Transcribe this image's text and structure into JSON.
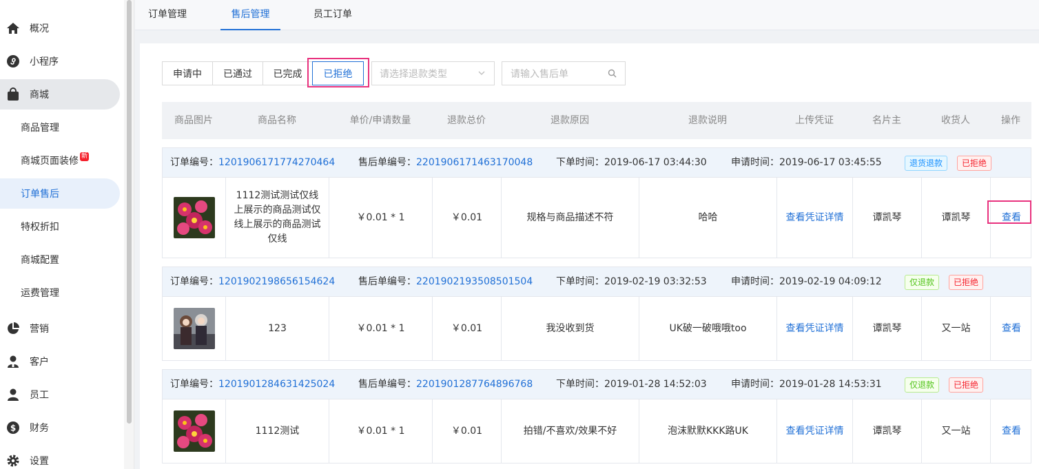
{
  "sidebar": {
    "items": [
      {
        "label": "概况",
        "icon": "home-icon"
      },
      {
        "label": "小程序",
        "icon": "mini-program-icon"
      },
      {
        "label": "商城",
        "icon": "shopping-bag-icon"
      },
      {
        "label": "商品管理"
      },
      {
        "label": "商城页面装修",
        "badge": "新"
      },
      {
        "label": "订单售后"
      },
      {
        "label": "特权折扣"
      },
      {
        "label": "商城配置"
      },
      {
        "label": "运费管理"
      },
      {
        "label": "营销",
        "icon": "pie-chart-icon"
      },
      {
        "label": "客户",
        "icon": "customer-icon"
      },
      {
        "label": "员工",
        "icon": "user-icon"
      },
      {
        "label": "财务",
        "icon": "dollar-icon"
      },
      {
        "label": "设置",
        "icon": "gear-icon"
      }
    ]
  },
  "tabs": [
    "订单管理",
    "售后管理",
    "员工订单"
  ],
  "filters": {
    "status": [
      "申请中",
      "已通过",
      "已完成",
      "已拒绝"
    ],
    "refund_type_placeholder": "请选择退款类型",
    "search_placeholder": "请输入售后单"
  },
  "table": {
    "headers": [
      "商品图片",
      "商品名称",
      "单价/申请数量",
      "退款总价",
      "退款原因",
      "退款说明",
      "上传凭证",
      "名片主",
      "收货人",
      "操作"
    ],
    "labels": {
      "order_no": "订单编号：",
      "aftersale_no": "售后单编号：",
      "order_time": "下单时间：",
      "apply_time": "申请时间："
    },
    "orders": [
      {
        "order_no": "1201906171774270464",
        "aftersale_no": "2201906171463170048",
        "order_time": "2019-06-17 03:44:30",
        "apply_time": "2019-06-17 03:45:55",
        "type_tag": "退货退款",
        "status_tag": "已拒绝",
        "product_name": "1112测试测试仅线上展示的商品测试仅线上展示的商品测试仅线",
        "price_qty": "￥0.01 * 1",
        "refund_total": "￥0.01",
        "reason": "规格与商品描述不符",
        "description": "哈哈",
        "proof_link": "查看凭证详情",
        "card_owner": "谭凯琴",
        "receiver": "谭凯琴",
        "action": "查看"
      },
      {
        "order_no": "1201902198656154624",
        "aftersale_no": "2201902193508501504",
        "order_time": "2019-02-19 03:32:53",
        "apply_time": "2019-02-19 04:09:12",
        "type_tag": "仅退款",
        "status_tag": "已拒绝",
        "product_name": "123",
        "price_qty": "￥0.01 * 1",
        "refund_total": "￥0.01",
        "reason": "我没收到货",
        "description": "UK破一破哦哦too",
        "proof_link": "查看凭证详情",
        "card_owner": "谭凯琴",
        "receiver": "又一站",
        "action": "查看"
      },
      {
        "order_no": "1201901284631425024",
        "aftersale_no": "2201901287764896768",
        "order_time": "2019-01-28 14:52:03",
        "apply_time": "2019-01-28 14:53:31",
        "type_tag": "仅退款",
        "status_tag": "已拒绝",
        "product_name": "1112测试",
        "price_qty": "￥0.01 * 1",
        "refund_total": "￥0.01",
        "reason": "拍错/不喜欢/效果不好",
        "description": "泡沫默默KKK路UK",
        "proof_link": "查看凭证详情",
        "card_owner": "谭凯琴",
        "receiver": "又一站",
        "action": "查看"
      }
    ]
  },
  "colors": {
    "accent": "#1f6fd6",
    "highlight": "#e8317d",
    "tag_blue": "#1890ff",
    "tag_green": "#52c41a",
    "tag_red": "#f5222d"
  }
}
